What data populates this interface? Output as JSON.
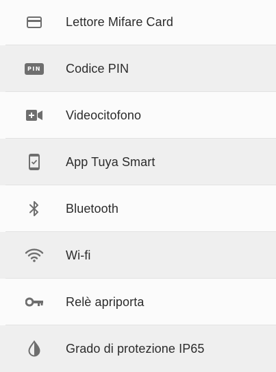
{
  "features": [
    {
      "icon": "card-icon",
      "label": "Lettore Mifare Card"
    },
    {
      "icon": "pin-icon",
      "icon_text": "PIN",
      "label": "Codice PIN"
    },
    {
      "icon": "video-camera-icon",
      "label": "Videocitofono"
    },
    {
      "icon": "smartphone-check-icon",
      "label": "App Tuya Smart"
    },
    {
      "icon": "bluetooth-icon",
      "label": "Bluetooth"
    },
    {
      "icon": "wifi-icon",
      "label": "Wi-fi"
    },
    {
      "icon": "key-icon",
      "label": "Relè apriporta"
    },
    {
      "icon": "water-drop-icon",
      "label": "Grado di protezione IP65"
    }
  ],
  "colors": {
    "icon": "#6e6e6e",
    "text": "#2b2b2b",
    "row_stripe": "#efefef",
    "row_white": "#fbfbfb"
  }
}
